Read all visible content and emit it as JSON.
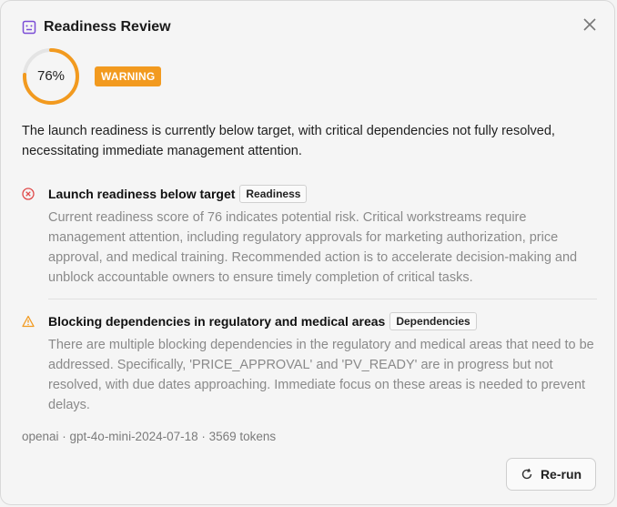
{
  "dialog": {
    "title": "Readiness Review",
    "title_icon": "robot-icon",
    "close_icon": "close-icon"
  },
  "score": {
    "value_text": "76%",
    "value": 76,
    "badge": "WARNING",
    "color": "#f29a1f"
  },
  "summary": "The launch readiness is currently below target, with critical dependencies not fully resolved, necessitating immediate management attention.",
  "issues": [
    {
      "icon": "error-circle-icon",
      "title": "Launch readiness below target",
      "tag": "Readiness",
      "body": "Current readiness score of 76 indicates potential risk. Critical workstreams require management attention, including regulatory approvals for marketing authorization, price approval, and medical training. Recommended action is to accelerate decision-making and unblock accountable owners to ensure timely completion of critical tasks."
    },
    {
      "icon": "warning-triangle-icon",
      "title": "Blocking dependencies in regulatory and medical areas",
      "tag": "Dependencies",
      "body": "There are multiple blocking dependencies in the regulatory and medical areas that need to be addressed. Specifically, 'PRICE_APPROVAL' and 'PV_READY' are in progress but not resolved, with due dates approaching. Immediate focus on these areas is needed to prevent delays."
    }
  ],
  "meta": "openai · gpt-4o-mini-2024-07-18 · 3569 tokens",
  "actions": {
    "rerun_label": "Re-run",
    "rerun_icon": "refresh-icon"
  },
  "colors": {
    "error": "#e04a4a",
    "warning": "#f29a1f",
    "accent_purple": "#7b4dd6"
  }
}
